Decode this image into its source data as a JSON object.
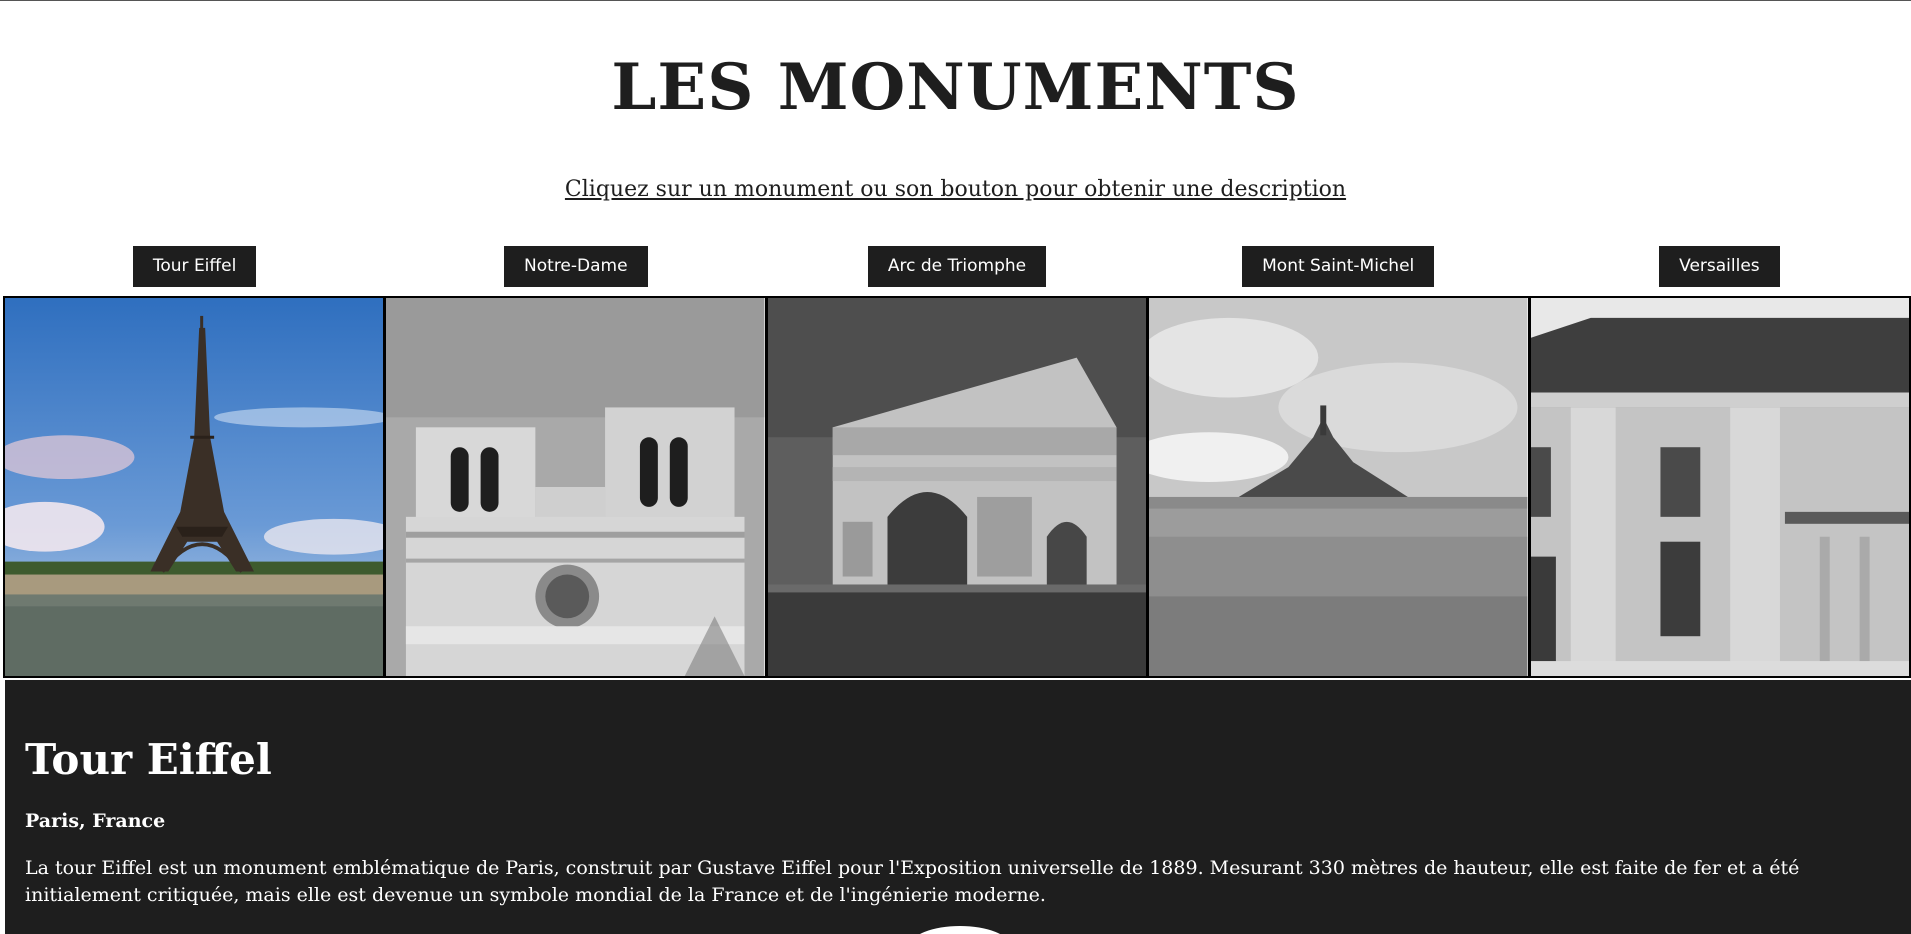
{
  "page": {
    "title": "LES MONUMENTS",
    "subtitle": "Cliquez sur un monument ou son bouton pour obtenir une description"
  },
  "monuments": [
    {
      "label": "Tour Eiffel"
    },
    {
      "label": "Notre-Dame"
    },
    {
      "label": "Arc de Triomphe"
    },
    {
      "label": "Mont Saint-Michel"
    },
    {
      "label": "Versailles"
    }
  ],
  "description": {
    "title": "Tour Eiffel",
    "location": "Paris, France",
    "text": "La tour Eiffel est un monument emblématique de Paris, construit par Gustave Eiffel pour l'Exposition universelle de 1889. Mesurant 330 mètres de hauteur, elle est faite de fer et a été initialement critiquée, mais elle est devenue un symbole mondial de la France et de l'ingénierie moderne."
  },
  "colors": {
    "dark": "#1e1e1e",
    "white": "#ffffff",
    "sky_blue": "#3f7fc4"
  }
}
